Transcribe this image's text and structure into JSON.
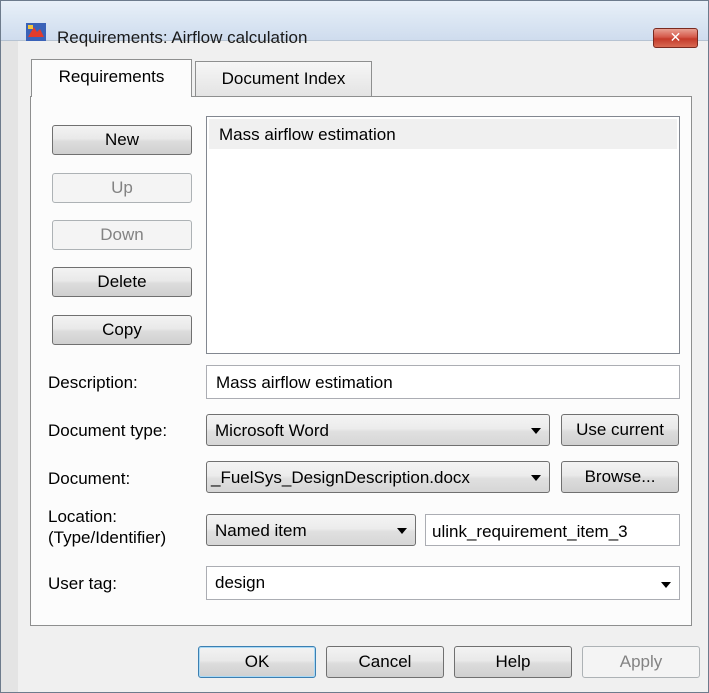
{
  "window": {
    "title": "Requirements: Airflow calculation",
    "close_glyph": "✕"
  },
  "tabs": [
    {
      "label": "Requirements",
      "active": true
    },
    {
      "label": "Document Index",
      "active": false
    }
  ],
  "side_buttons": {
    "new": "New",
    "up": "Up",
    "down": "Down",
    "delete": "Delete",
    "copy": "Copy"
  },
  "requirements_list": {
    "items": [
      "Mass airflow estimation"
    ],
    "selected_index": 0
  },
  "fields": {
    "description_label": "Description:",
    "description_value": "Mass airflow estimation",
    "document_type_label": "Document type:",
    "document_type_value": "Microsoft Word",
    "use_current_label": "Use current",
    "document_label": "Document:",
    "document_value": "_FuelSys_DesignDescription.docx",
    "browse_label": "Browse...",
    "location_label_1": "Location:",
    "location_label_2": "(Type/Identifier)",
    "location_type_value": "Named item",
    "location_identifier_value": "ulink_requirement_item_3",
    "user_tag_label": "User tag:",
    "user_tag_value": "design"
  },
  "footer_buttons": {
    "ok": "OK",
    "cancel": "Cancel",
    "help": "Help",
    "apply": "Apply"
  },
  "colors": {
    "titlebar": "#dbe6f3",
    "close_button": "#c43a2a",
    "dialog_background": "#f0f0f0",
    "focus_border": "#3c7fb1"
  },
  "icons": {
    "title_icon": "simulink-requirements-icon",
    "dropdown_icon": "chevron-down-icon"
  }
}
